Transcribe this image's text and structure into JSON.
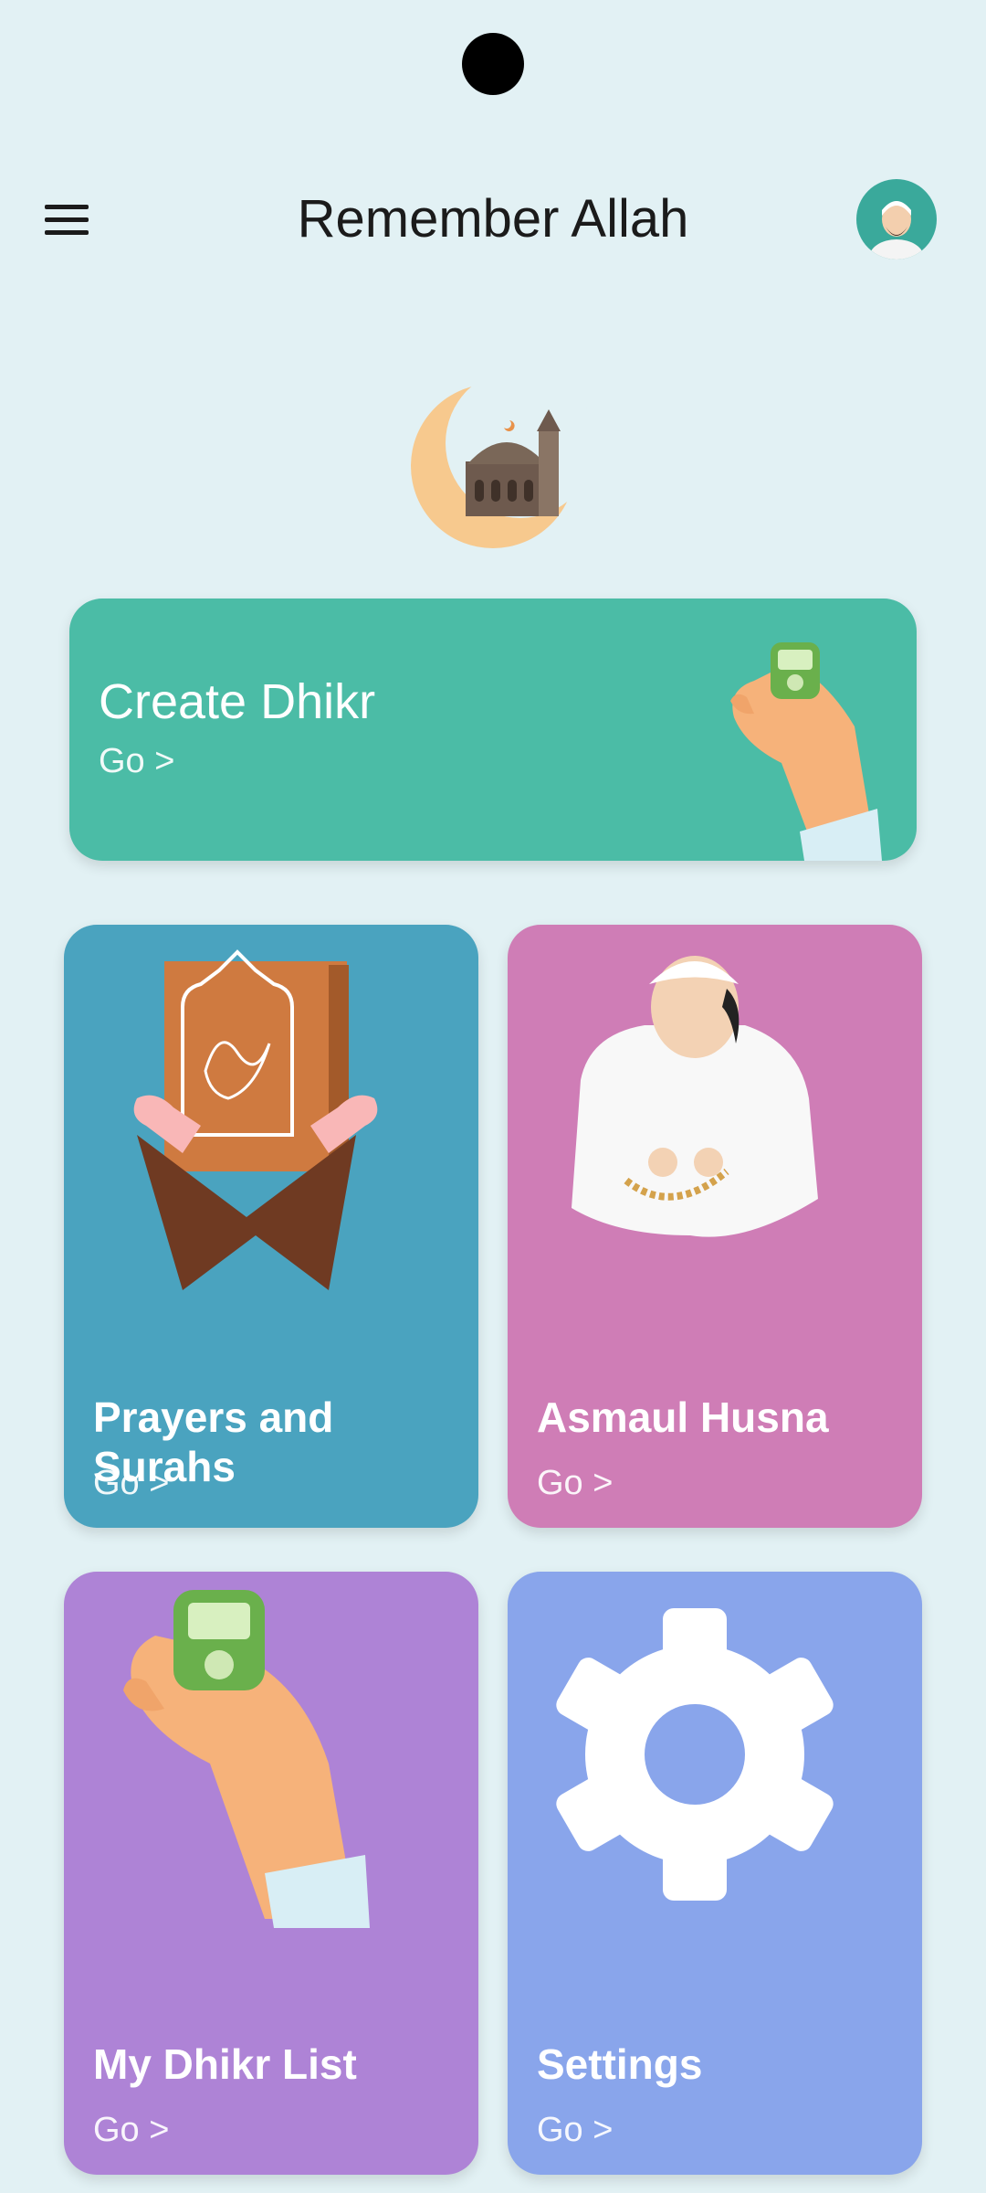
{
  "app": {
    "title": "Remember Allah"
  },
  "header": {
    "menu_icon": "hamburger-menu-icon",
    "avatar_icon": "user-avatar-icon"
  },
  "hero": {
    "icon": "crescent-mosque-icon"
  },
  "cards": [
    {
      "id": "create_dhikr",
      "label": "Create Dhikr",
      "action": "Go >",
      "color": "#4bbca6",
      "icon": "tally-counter-hand-icon"
    },
    {
      "id": "prayers",
      "label": "Prayers and Surahs",
      "action": "Go >",
      "color": "#4aa3bf",
      "icon": "quran-book-icon"
    },
    {
      "id": "asmaul",
      "label": "Asmaul Husna",
      "action": "Go >",
      "color": "#cf7db6",
      "icon": "praying-man-icon"
    },
    {
      "id": "mylist",
      "label": "My Dhikr List",
      "action": "Go >",
      "color": "#ae83d6",
      "icon": "tally-counter-hand-icon"
    },
    {
      "id": "settings",
      "label": "Settings",
      "action": "Go >",
      "color": "#89a5eb",
      "icon": "gear-icon"
    }
  ],
  "colors": {
    "background": "#e2f1f4",
    "text": "#1b1b1b"
  }
}
